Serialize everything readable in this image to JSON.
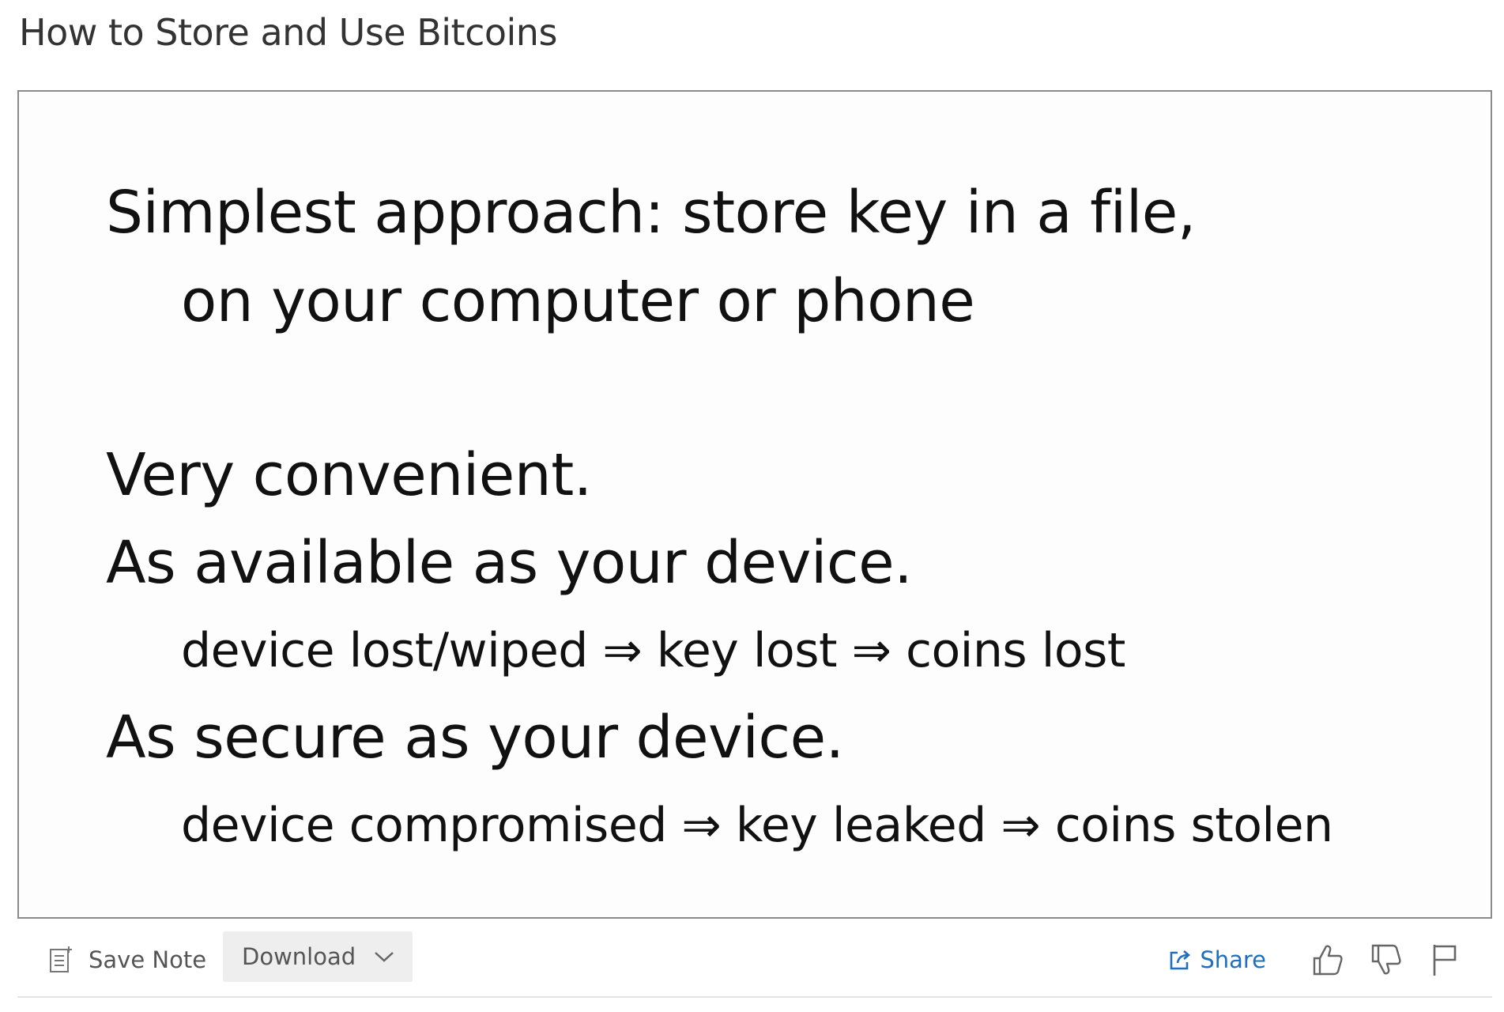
{
  "page": {
    "title": "How to Store and Use Bitcoins"
  },
  "slide": {
    "lines": [
      "Simplest approach: store key in a file,",
      "on your computer or phone",
      "Very convenient.",
      "As available as your device.",
      "device lost/wiped ⇒ key lost ⇒ coins lost",
      "As secure as your device.",
      "device compromised ⇒ key leaked ⇒ coins stolen"
    ]
  },
  "toolbar": {
    "save_note_label": "Save Note",
    "save_note_icon": "note-icon",
    "download_label": "Download",
    "download_icon": "chevron-down-icon",
    "share_label": "Share",
    "share_icon": "share-icon",
    "like_icon": "thumbs-up-icon",
    "dislike_icon": "thumbs-down-icon",
    "flag_icon": "flag-icon",
    "share_color": "#1f6fbf"
  }
}
